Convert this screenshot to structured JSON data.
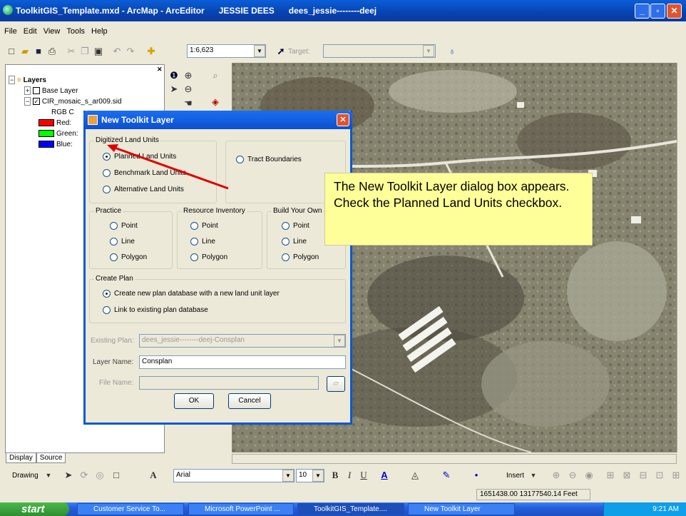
{
  "window": {
    "title": "ToolkitGIS_Template.mxd - ArcMap - ArcEditor      JESSIE DEES      dees_jessie--------deej",
    "controls": {
      "minimize": "_",
      "maximize": "▫",
      "close": "✕"
    }
  },
  "menu": [
    "File",
    "Edit",
    "View",
    "Tools",
    "Help"
  ],
  "toolbar": {
    "scale": "1:6,623",
    "target_label": "Target:",
    "target_value": ""
  },
  "toc": {
    "layers_label": "Layers",
    "items": [
      "Base Layer",
      "CIR_mosaic_s_ar009.sid",
      "RGB C",
      "Red:",
      "Green:",
      "Blue:"
    ]
  },
  "colors": {
    "red": "#ff0000",
    "green": "#00ff00",
    "blue": "#0000ff",
    "title_blue": "#0a5fd8",
    "callout": "#ffff99"
  },
  "tabs": {
    "display": "Display",
    "source": "Source"
  },
  "drawing": {
    "drawing_label": "Drawing",
    "font": "Arial",
    "size": "10",
    "insert": "Insert"
  },
  "status": {
    "coords": "1651438.00  13177540.14 Feet"
  },
  "taskbar": {
    "start": "start",
    "tasks": [
      "Customer Service To...",
      "Microsoft PowerPoint ...",
      "ToolkitGIS_Template....",
      "New Toolkit Layer"
    ],
    "time": "9:21 AM"
  },
  "dialog": {
    "title": "New Toolkit Layer",
    "digitized_group": "Digitized Land Units",
    "planned": "Planned Land Units",
    "benchmark": "Benchmark Land Units",
    "alternative": "Alternative Land Units",
    "tract": "Tract Boundaries",
    "practice": "Practice",
    "resource": "Resource Inventory",
    "build": "Build Your Own",
    "point": "Point",
    "line": "Line",
    "polygon": "Polygon",
    "create_plan": "Create Plan",
    "create_new": "Create new plan database with a new land unit layer",
    "link_existing": "Link to existing plan database",
    "existing_plan_label": "Existing Plan:",
    "existing_plan_value": "dees_jessie--------deej-Consplan",
    "layer_name_label": "Layer Name:",
    "layer_name_value": "Consplan",
    "file_name_label": "File Name:",
    "file_name_value": "",
    "ok": "OK",
    "cancel": "Cancel"
  },
  "callout": {
    "text": "The New Toolkit Layer dialog box appears. Check the Planned Land Units checkbox."
  }
}
